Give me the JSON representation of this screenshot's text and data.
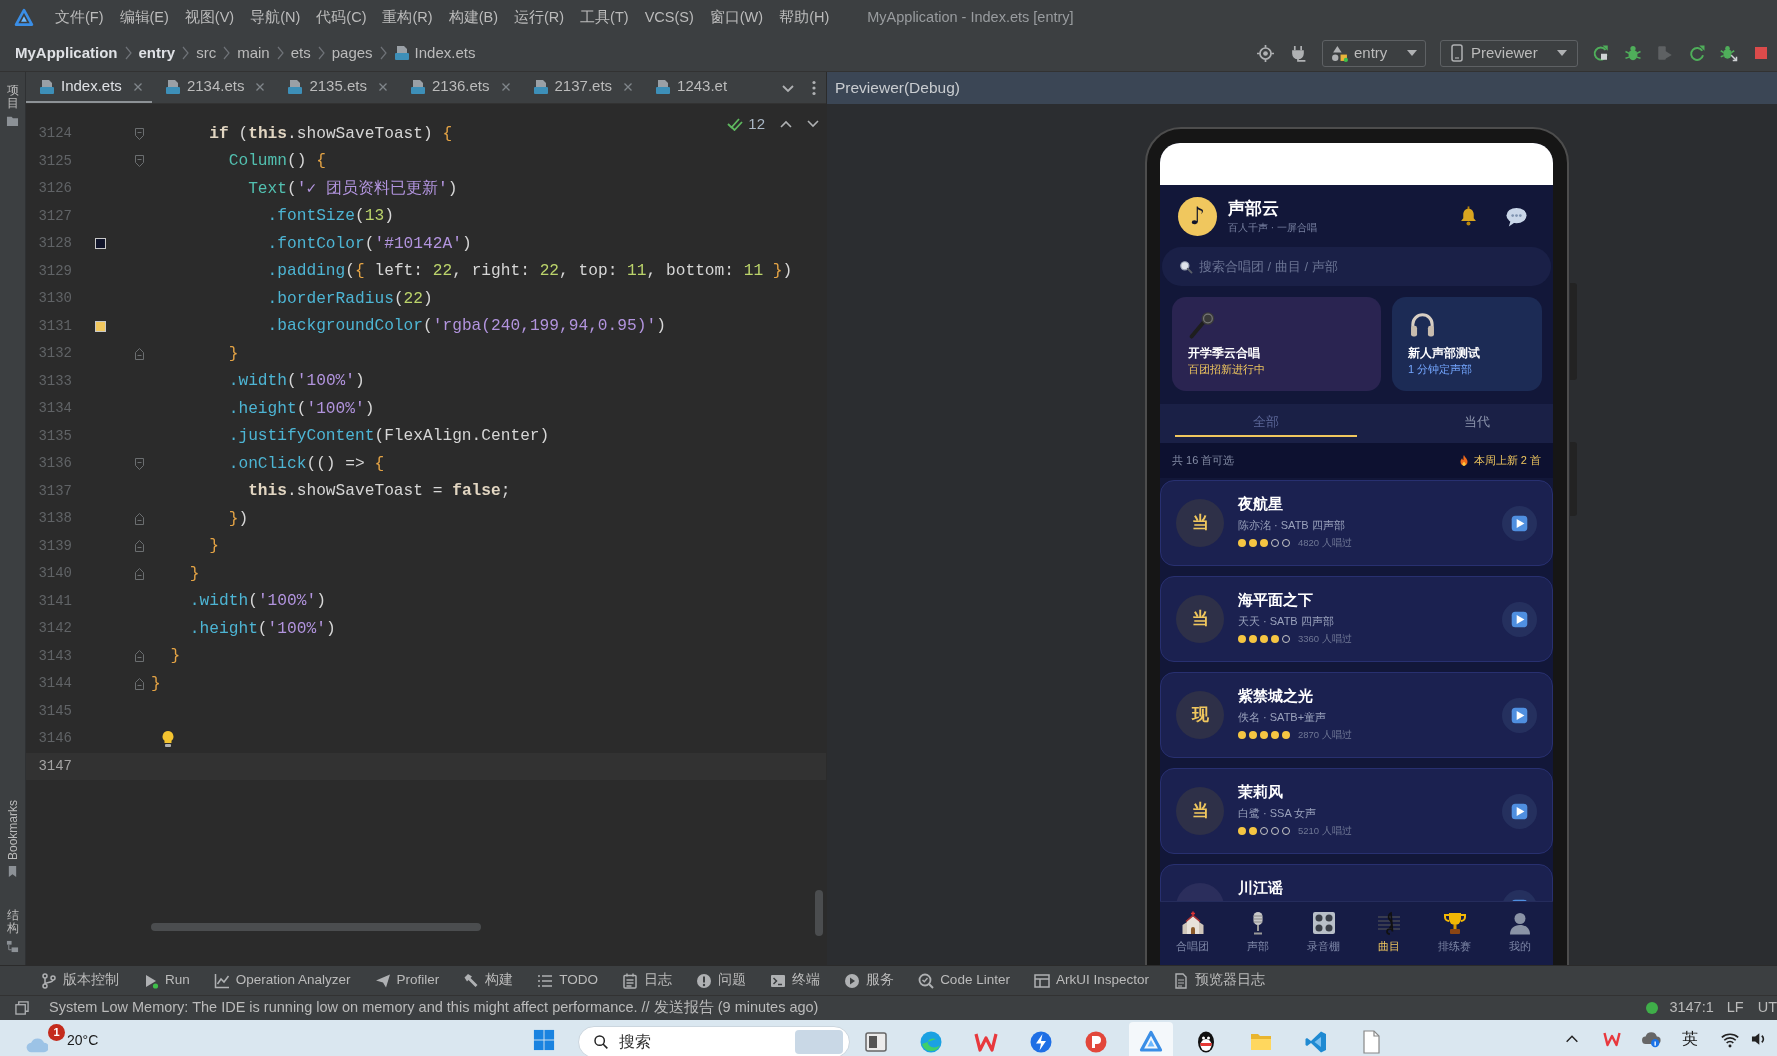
{
  "menubar": {
    "items": [
      "文件(F)",
      "编辑(E)",
      "视图(V)",
      "导航(N)",
      "代码(C)",
      "重构(R)",
      "构建(B)",
      "运行(R)",
      "工具(T)",
      "VCS(S)",
      "窗口(W)",
      "帮助(H)"
    ],
    "title": "MyApplication - Index.ets [entry]"
  },
  "navbar": {
    "breadcrumb": [
      {
        "label": "MyApplication",
        "kind": "project"
      },
      {
        "label": "entry",
        "kind": "module"
      },
      {
        "label": "src",
        "kind": "folder"
      },
      {
        "label": "main",
        "kind": "folder"
      },
      {
        "label": "ets",
        "kind": "folder"
      },
      {
        "label": "pages",
        "kind": "folder"
      },
      {
        "label": "Index.ets",
        "kind": "file"
      }
    ],
    "run_target": "entry",
    "device": "Previewer",
    "actions": [
      {
        "disabled": false
      },
      {
        "disabled": false
      },
      {
        "disabled": true
      },
      {
        "disabled": false
      },
      {
        "disabled": false
      },
      {
        "disabled": false
      }
    ]
  },
  "side_strip": {
    "top": [
      "项目"
    ],
    "bookmarks": "Bookmarks",
    "structure": "结构"
  },
  "editor": {
    "tabs": [
      {
        "label": "Index.ets",
        "selected": true,
        "truncated": false
      },
      {
        "label": "2134.ets",
        "selected": false,
        "truncated": false
      },
      {
        "label": "2135.ets",
        "selected": false,
        "truncated": false
      },
      {
        "label": "2136.ets",
        "selected": false,
        "truncated": false
      },
      {
        "label": "2137.ets",
        "selected": false,
        "truncated": false
      },
      {
        "label": "1243.et",
        "selected": false,
        "truncated": true
      }
    ],
    "inspections": "12",
    "lines": [
      {
        "number": "3124",
        "kind": "opener",
        "current": false,
        "bulb": false,
        "tokens": [
          {
            "text": "      if",
            "kind": "keyword"
          },
          {
            "text": " (",
            "kind": "plain"
          },
          {
            "text": "this",
            "kind": "keyword"
          },
          {
            "text": ".showSaveToast",
            "kind": "field"
          },
          {
            "text": ") ",
            "kind": "plain"
          },
          {
            "text": "{",
            "kind": "brace"
          }
        ]
      },
      {
        "number": "3125",
        "kind": "opener",
        "current": false,
        "bulb": false,
        "tokens": [
          {
            "text": "        Column",
            "kind": "component"
          },
          {
            "text": "() ",
            "kind": "plain"
          },
          {
            "text": "{",
            "kind": "brace"
          }
        ]
      },
      {
        "number": "3126",
        "kind": "plain",
        "current": false,
        "bulb": false,
        "tokens": [
          {
            "text": "          Text",
            "kind": "component"
          },
          {
            "text": "(",
            "kind": "plain"
          },
          {
            "text": "'✓ 团员资料已更新'",
            "kind": "string"
          },
          {
            "text": ")",
            "kind": "plain"
          }
        ]
      },
      {
        "number": "3127",
        "kind": "plain",
        "current": false,
        "bulb": false,
        "tokens": [
          {
            "text": "            .fontSize",
            "kind": "method"
          },
          {
            "text": "(",
            "kind": "plain"
          },
          {
            "text": "13",
            "kind": "number"
          },
          {
            "text": ")",
            "kind": "plain"
          }
        ]
      },
      {
        "number": "3128",
        "kind": "plain",
        "current": false,
        "bulb": false,
        "color": "#10142a",
        "tokens": [
          {
            "text": "            .fontColor",
            "kind": "method"
          },
          {
            "text": "(",
            "kind": "plain"
          },
          {
            "text": "'#10142A'",
            "kind": "string"
          },
          {
            "text": ")",
            "kind": "plain"
          }
        ]
      },
      {
        "number": "3129",
        "kind": "plain",
        "current": false,
        "bulb": false,
        "tokens": [
          {
            "text": "            .padding",
            "kind": "method"
          },
          {
            "text": "(",
            "kind": "plain"
          },
          {
            "text": "{ ",
            "kind": "brace"
          },
          {
            "text": "left",
            "kind": "prop"
          },
          {
            "text": ": ",
            "kind": "plain"
          },
          {
            "text": "22",
            "kind": "number"
          },
          {
            "text": ", ",
            "kind": "plain"
          },
          {
            "text": "right",
            "kind": "prop"
          },
          {
            "text": ": ",
            "kind": "plain"
          },
          {
            "text": "22",
            "kind": "number"
          },
          {
            "text": ", ",
            "kind": "plain"
          },
          {
            "text": "top",
            "kind": "prop"
          },
          {
            "text": ": ",
            "kind": "plain"
          },
          {
            "text": "11",
            "kind": "number"
          },
          {
            "text": ", ",
            "kind": "plain"
          },
          {
            "text": "bottom",
            "kind": "prop"
          },
          {
            "text": ": ",
            "kind": "plain"
          },
          {
            "text": "11",
            "kind": "number"
          },
          {
            "text": " }",
            "kind": "brace"
          },
          {
            "text": ")",
            "kind": "plain"
          }
        ]
      },
      {
        "number": "3130",
        "kind": "plain",
        "current": false,
        "bulb": false,
        "tokens": [
          {
            "text": "            .borderRadius",
            "kind": "method"
          },
          {
            "text": "(",
            "kind": "plain"
          },
          {
            "text": "22",
            "kind": "number"
          },
          {
            "text": ")",
            "kind": "plain"
          }
        ]
      },
      {
        "number": "3131",
        "kind": "plain",
        "current": false,
        "bulb": false,
        "color": "#f0c75e",
        "tokens": [
          {
            "text": "            .backgroundColor",
            "kind": "method"
          },
          {
            "text": "(",
            "kind": "plain"
          },
          {
            "text": "'rgba(240,199,94,0.95)'",
            "kind": "string"
          },
          {
            "text": ")",
            "kind": "plain"
          }
        ]
      },
      {
        "number": "3132",
        "kind": "closer",
        "current": false,
        "bulb": false,
        "tokens": [
          {
            "text": "        }",
            "kind": "brace"
          }
        ]
      },
      {
        "number": "3133",
        "kind": "plain",
        "current": false,
        "bulb": false,
        "tokens": [
          {
            "text": "        .width",
            "kind": "method"
          },
          {
            "text": "(",
            "kind": "plain"
          },
          {
            "text": "'100%'",
            "kind": "string"
          },
          {
            "text": ")",
            "kind": "plain"
          }
        ]
      },
      {
        "number": "3134",
        "kind": "plain",
        "current": false,
        "bulb": false,
        "tokens": [
          {
            "text": "        .height",
            "kind": "method"
          },
          {
            "text": "(",
            "kind": "plain"
          },
          {
            "text": "'100%'",
            "kind": "string"
          },
          {
            "text": ")",
            "kind": "plain"
          }
        ]
      },
      {
        "number": "3135",
        "kind": "plain",
        "current": false,
        "bulb": false,
        "tokens": [
          {
            "text": "        .justifyContent",
            "kind": "method"
          },
          {
            "text": "(FlexAlign.Center)",
            "kind": "plain"
          }
        ]
      },
      {
        "number": "3136",
        "kind": "opener",
        "current": false,
        "bulb": false,
        "tokens": [
          {
            "text": "        .onClick",
            "kind": "method"
          },
          {
            "text": "(() => ",
            "kind": "plain"
          },
          {
            "text": "{",
            "kind": "brace"
          }
        ]
      },
      {
        "number": "3137",
        "kind": "plain",
        "current": false,
        "bulb": false,
        "tokens": [
          {
            "text": "          this",
            "kind": "keyword"
          },
          {
            "text": ".showSaveToast",
            "kind": "field"
          },
          {
            "text": " = ",
            "kind": "plain"
          },
          {
            "text": "false",
            "kind": "keyword"
          },
          {
            "text": ";",
            "kind": "plain"
          }
        ]
      },
      {
        "number": "3138",
        "kind": "closer",
        "current": false,
        "bulb": false,
        "tokens": [
          {
            "text": "        }",
            "kind": "brace"
          },
          {
            "text": ")",
            "kind": "plain"
          }
        ]
      },
      {
        "number": "3139",
        "kind": "closer",
        "current": false,
        "bulb": false,
        "tokens": [
          {
            "text": "      }",
            "kind": "brace"
          }
        ]
      },
      {
        "number": "3140",
        "kind": "closer",
        "current": false,
        "bulb": false,
        "tokens": [
          {
            "text": "    }",
            "kind": "brace"
          }
        ]
      },
      {
        "number": "3141",
        "kind": "plain",
        "current": false,
        "bulb": false,
        "tokens": [
          {
            "text": "    .width",
            "kind": "method"
          },
          {
            "text": "(",
            "kind": "plain"
          },
          {
            "text": "'100%'",
            "kind": "string"
          },
          {
            "text": ")",
            "kind": "plain"
          }
        ]
      },
      {
        "number": "3142",
        "kind": "plain",
        "current": false,
        "bulb": false,
        "tokens": [
          {
            "text": "    .height",
            "kind": "method"
          },
          {
            "text": "(",
            "kind": "plain"
          },
          {
            "text": "'100%'",
            "kind": "string"
          },
          {
            "text": ")",
            "kind": "plain"
          }
        ]
      },
      {
        "number": "3143",
        "kind": "closer",
        "current": false,
        "bulb": false,
        "tokens": [
          {
            "text": "  }",
            "kind": "brace"
          }
        ]
      },
      {
        "number": "3144",
        "kind": "closer",
        "current": false,
        "bulb": false,
        "tokens": [
          {
            "text": "}",
            "kind": "brace"
          }
        ]
      },
      {
        "number": "3145",
        "kind": "plain",
        "current": false,
        "bulb": false
      },
      {
        "number": "3146",
        "kind": "plain",
        "current": false,
        "bulb": true
      },
      {
        "number": "3147",
        "kind": "plain",
        "current": true,
        "bulb": false
      }
    ]
  },
  "previewer": {
    "title": "Previewer(Debug)",
    "app": {
      "logo": "♪",
      "name": "声部云",
      "tagline": "百人千声 · 一屏合唱",
      "search": {
        "placeholder": "搜索合唱团 / 曲目 / 声部"
      },
      "banners": [
        {
          "kind": "event",
          "title": "开学季云合唱",
          "subtitle": "百团招新进行中"
        },
        {
          "kind": "test",
          "title": "新人声部测试",
          "subtitle": "1 分钟定声部"
        }
      ],
      "tabs": [
        {
          "label": "全部",
          "selected": true
        },
        {
          "label": "当代",
          "selected": false
        }
      ],
      "summary": {
        "count": "共 16 首可选",
        "new_this_week": "本周上新 2 首"
      },
      "songs": [
        {
          "badge": "当",
          "title": "夜航星",
          "meta": "陈亦洺 · SATB 四声部",
          "stars": 3,
          "plays": "4820 人唱过"
        },
        {
          "badge": "当",
          "title": "海平面之下",
          "meta": "天天 · SATB 四声部",
          "stars": 4,
          "plays": "3360 人唱过"
        },
        {
          "badge": "现",
          "title": "紫禁城之光",
          "meta": "佚名 · SATB+童声",
          "stars": 5,
          "plays": "2870 人唱过"
        },
        {
          "badge": "当",
          "title": "茉莉风",
          "meta": "白鹭 · SSA 女声",
          "stars": 2,
          "plays": "5210 人唱过"
        },
        {
          "title": "川江谣"
        }
      ],
      "nav": [
        {
          "label": "合唱团",
          "selected": false
        },
        {
          "label": "声部",
          "selected": false
        },
        {
          "label": "录音棚",
          "selected": false
        },
        {
          "label": "曲目",
          "selected": true
        },
        {
          "label": "排练赛",
          "selected": false
        },
        {
          "label": "我的",
          "selected": false
        }
      ]
    }
  },
  "tool_windows": [
    {
      "label": "版本控制",
      "running": false
    },
    {
      "label": "Run",
      "running": true
    },
    {
      "label": "Operation Analyzer",
      "running": false
    },
    {
      "label": "Profiler",
      "running": false
    },
    {
      "label": "构建",
      "running": false
    },
    {
      "label": "TODO",
      "running": false
    },
    {
      "label": "日志",
      "running": false
    },
    {
      "label": "问题",
      "running": false
    },
    {
      "label": "终端",
      "running": false
    },
    {
      "label": "服务",
      "running": false
    },
    {
      "label": "Code Linter",
      "running": false
    },
    {
      "label": "ArkUI Inspector",
      "running": false
    },
    {
      "label": "预览器日志",
      "running": false
    }
  ],
  "status_bar": {
    "message": "System Low Memory: The IDE is running low on memory and this might affect performance. // 发送报告 (9 minutes ago)",
    "position": "3147:1",
    "line_separator": "LF",
    "encoding": "UT"
  },
  "taskbar": {
    "weather_badge": "1",
    "temperature": "20°C",
    "search": {
      "placeholder": "搜索"
    },
    "apps": [
      {
        "active": false
      },
      {
        "active": false
      },
      {
        "active": false
      },
      {
        "active": false
      },
      {
        "active": false
      },
      {
        "active": true
      },
      {
        "active": false
      },
      {
        "active": false
      },
      {
        "active": false
      },
      {
        "active": false
      }
    ],
    "ime": "英"
  }
}
